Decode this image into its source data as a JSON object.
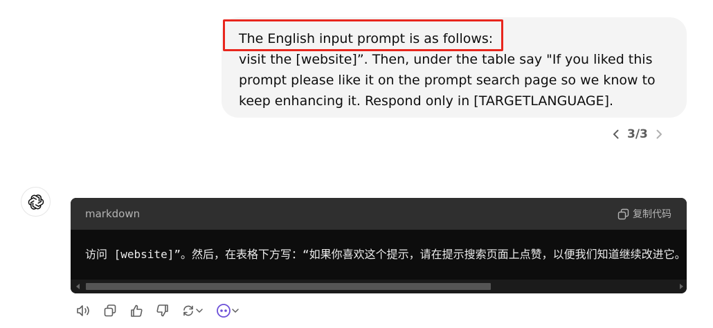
{
  "user_message": {
    "lines": [
      "The English input prompt is as follows:",
      "visit the [website]”. Then, under the table say \"If you liked this",
      "prompt please like it on the prompt search page so we know to",
      "keep enhancing it. Respond only in [TARGETLANGUAGE]."
    ]
  },
  "pager": {
    "label": "3/3"
  },
  "code_block": {
    "language": "markdown",
    "copy_label": "复制代码",
    "content": "访问 [website]”。然后，在表格下方写：“如果你喜欢这个提示，请在提示搜索页面上点赞，以便我们知道继续改进它。"
  },
  "colors": {
    "highlight_border": "#e8261d",
    "bubble_bg": "#f4f4f4",
    "code_header_bg": "#2f2f2f",
    "code_bg": "#0d0d0d"
  },
  "icons": {
    "avatar": "openai-logo-icon",
    "actions": [
      "read-aloud-icon",
      "copy-icon",
      "thumbs-up-icon",
      "thumbs-down-icon",
      "regenerate-icon",
      "model-switch-icon"
    ]
  }
}
